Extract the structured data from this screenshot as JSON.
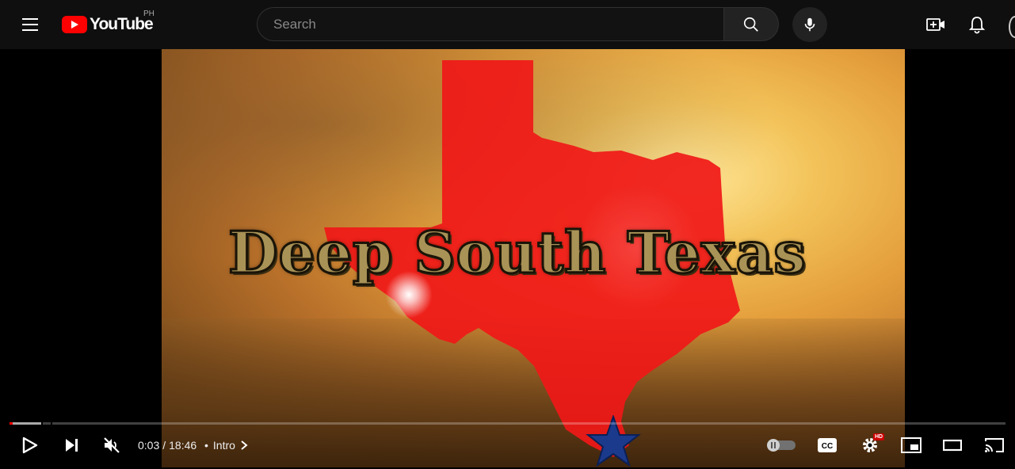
{
  "header": {
    "logo_text": "YouTube",
    "region": "PH",
    "search_placeholder": "Search",
    "icons": [
      "menu-icon",
      "youtube-logo-icon",
      "search-icon",
      "mic-icon",
      "create-icon",
      "bell-icon"
    ]
  },
  "video": {
    "overlay_title": "Deep South Texas",
    "player": {
      "current_time": "0:03",
      "separator": "/",
      "duration": "18:46",
      "chapter_bullet": "•",
      "chapter_label": "Intro",
      "played_fraction": 0.003,
      "buffered_fraction": 0.033,
      "hd_badge": "HD",
      "cc_label": "CC",
      "icons": [
        "play-icon",
        "next-icon",
        "muted-volume-icon",
        "autoplay-toggle-icon",
        "subtitles-icon",
        "settings-icon",
        "miniplayer-icon",
        "theater-icon",
        "cast-icon"
      ]
    }
  },
  "colors": {
    "accent": "#ff0000",
    "topbar_bg": "#0f0f0f",
    "texas_red": "#f01818",
    "star_blue": "#1b3a8c"
  }
}
